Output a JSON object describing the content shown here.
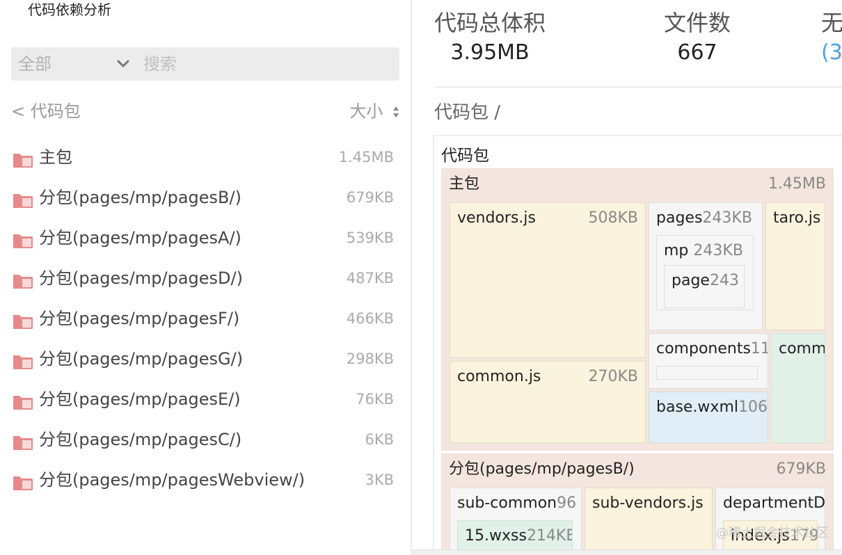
{
  "app": {
    "title": "代码依赖分析"
  },
  "filter": {
    "selected": "全部",
    "search_placeholder": "搜索"
  },
  "list_header": {
    "back_label": "< 代码包",
    "sort_label": "大小"
  },
  "packages": [
    {
      "name": "主包",
      "size": "1.45MB"
    },
    {
      "name": "分包(pages/mp/pagesB/)",
      "size": "679KB"
    },
    {
      "name": "分包(pages/mp/pagesA/)",
      "size": "539KB"
    },
    {
      "name": "分包(pages/mp/pagesD/)",
      "size": "487KB"
    },
    {
      "name": "分包(pages/mp/pagesF/)",
      "size": "466KB"
    },
    {
      "name": "分包(pages/mp/pagesG/)",
      "size": "298KB"
    },
    {
      "name": "分包(pages/mp/pagesE/)",
      "size": "76KB"
    },
    {
      "name": "分包(pages/mp/pagesC/)",
      "size": "6KB"
    },
    {
      "name": "分包(pages/mp/pagesWebview/)",
      "size": "3KB"
    }
  ],
  "stats": {
    "total_size_label": "代码总体积",
    "total_size_value": "3.95MB",
    "file_count_label": "文件数",
    "file_count_value": "667",
    "third_label": "无",
    "third_value": "(3"
  },
  "breadcrumb": "代码包 /",
  "treemap": {
    "root_label": "代码包",
    "main": {
      "name": "主包",
      "size": "1.45MB"
    },
    "vendors": {
      "name": "vendors.js",
      "size": "508KB"
    },
    "common": {
      "name": "common.js",
      "size": "270KB"
    },
    "pages": {
      "name": "pages",
      "size": "243KB"
    },
    "mp": {
      "name": "mp",
      "size": "243KB"
    },
    "page": {
      "name": "page",
      "size": "243"
    },
    "taro": {
      "name": "taro.js",
      "size": ""
    },
    "components": {
      "name": "components",
      "size": "11"
    },
    "comm": {
      "name": "comm",
      "size": ""
    },
    "base_wxml": {
      "name": "base.wxml",
      "size": "106"
    },
    "pkgB": {
      "name": "分包(pages/mp/pagesB/)",
      "size": "679KB"
    },
    "sub_common": {
      "name": "sub-common",
      "size": "96"
    },
    "wxss": {
      "name": "15.wxss",
      "size": "214KE"
    },
    "sub_vendors": {
      "name": "sub-vendors.js",
      "size": ""
    },
    "department": {
      "name": "departmentD",
      "size": ""
    },
    "index": {
      "name": "index.js",
      "size": "179"
    }
  },
  "watermark": "@稀土掘金技术社区",
  "colors": {
    "folder": "#e58a8a",
    "link": "#4ba0e0",
    "group_bg": "#f4e6de",
    "file_bg": "#faf3dd",
    "blue_file_bg": "#e1eef8",
    "green_file_bg": "#e1f1e8"
  }
}
